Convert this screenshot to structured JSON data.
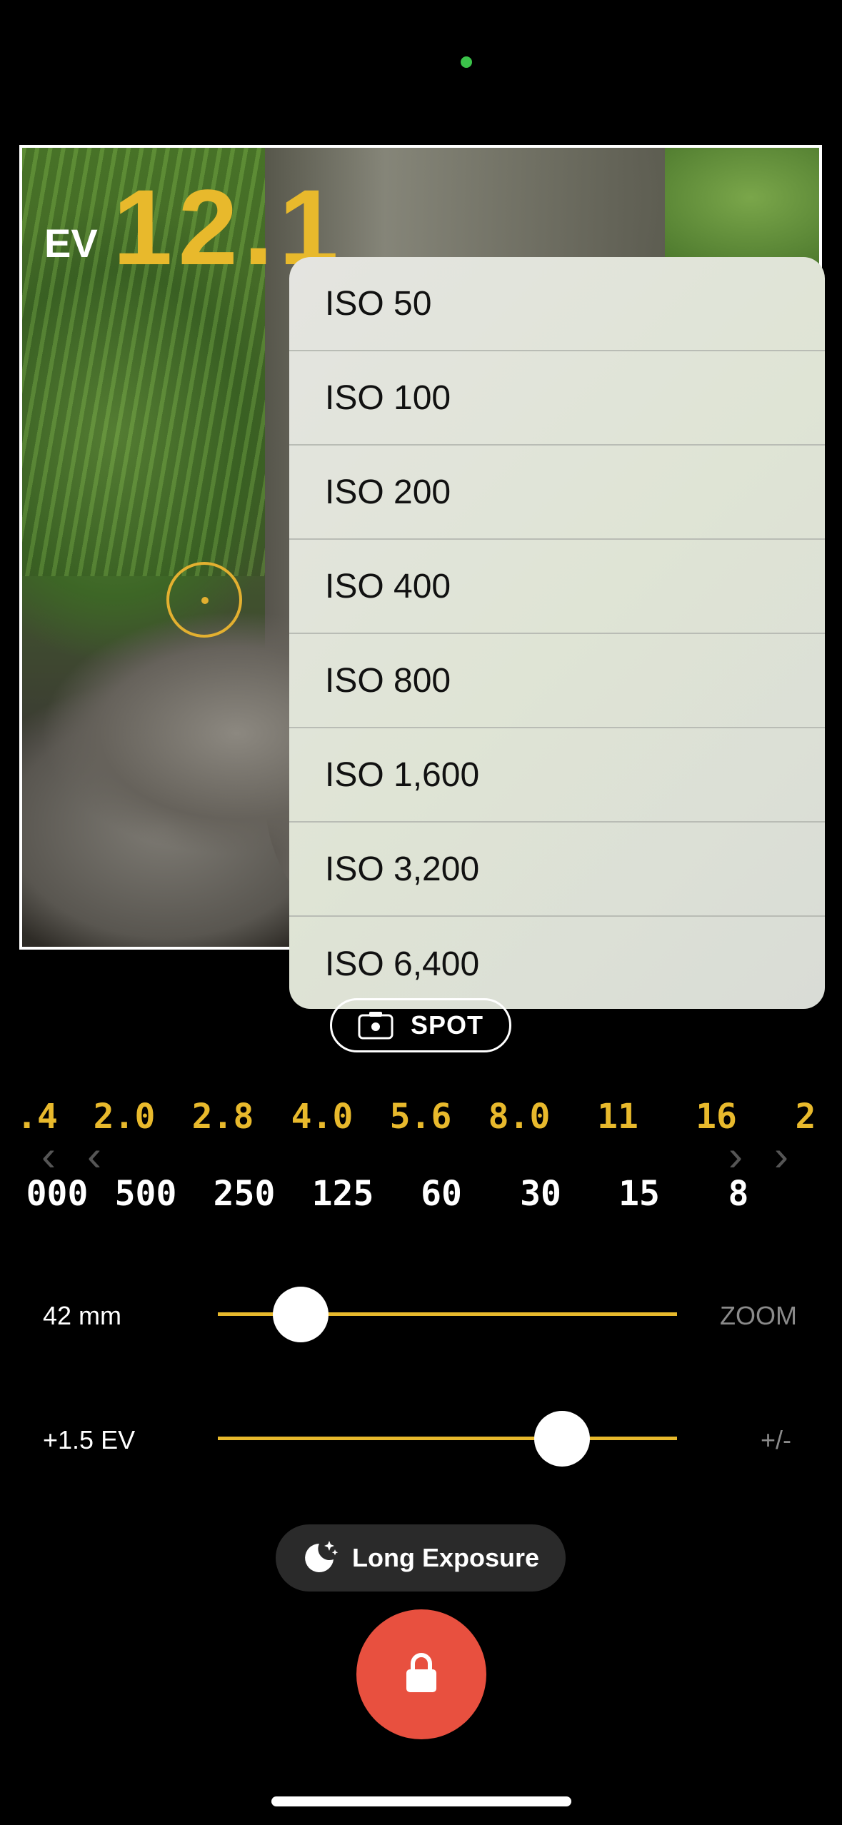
{
  "status": {
    "indicator_color": "#3bc34a"
  },
  "meter": {
    "ev_label": "EV",
    "ev_value": "12.1"
  },
  "iso_menu": {
    "items": [
      "ISO 50",
      "ISO 100",
      "ISO 200",
      "ISO 400",
      "ISO 800",
      "ISO 1,600",
      "ISO 3,200",
      "ISO 6,400"
    ]
  },
  "metering_mode": {
    "label": "SPOT",
    "icon": "spot-metering-icon"
  },
  "aperture_scale": [
    "4",
    "2.0",
    "2.8",
    "4.0",
    "5.6",
    "8.0",
    "11",
    "16",
    "2"
  ],
  "shutter_scale": [
    "000",
    "500",
    "250",
    "125",
    "60",
    "30",
    "15",
    "8"
  ],
  "zoom": {
    "label": "42 mm",
    "suffix": "ZOOM",
    "value_fraction": 0.18
  },
  "ev_comp": {
    "label": "+1.5 EV",
    "suffix": "+/-",
    "value_fraction": 0.75
  },
  "long_exposure": {
    "label": "Long Exposure",
    "icon": "moon-stars-icon"
  },
  "shutter_button": {
    "icon": "lock-icon",
    "color": "#e8503f"
  },
  "accent_color": "#e8b92c"
}
